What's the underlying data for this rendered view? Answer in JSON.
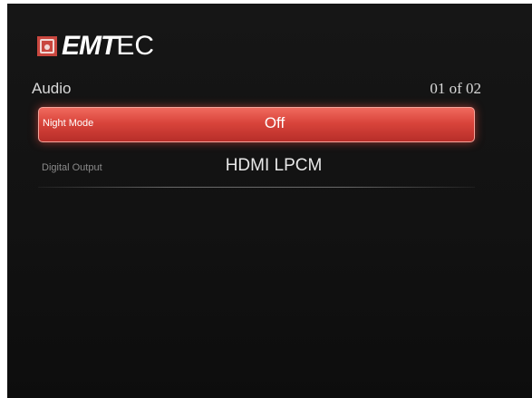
{
  "app": {
    "logo_text_bold": "EMT",
    "logo_text_thin": "EC",
    "logo_icon": "emtec-logo-mark"
  },
  "header": {
    "section_title": "Audio",
    "page_count": "01 of 02"
  },
  "menu": {
    "items": [
      {
        "label": "Night Mode",
        "value": "Off",
        "selected": true
      },
      {
        "label": "Digital Output",
        "value": "HDMI LPCM",
        "selected": false
      }
    ]
  },
  "colors": {
    "background": "#141414",
    "highlight": "#d9443b",
    "text": "#e8e8e8",
    "label_dim": "#8a8a8a"
  }
}
